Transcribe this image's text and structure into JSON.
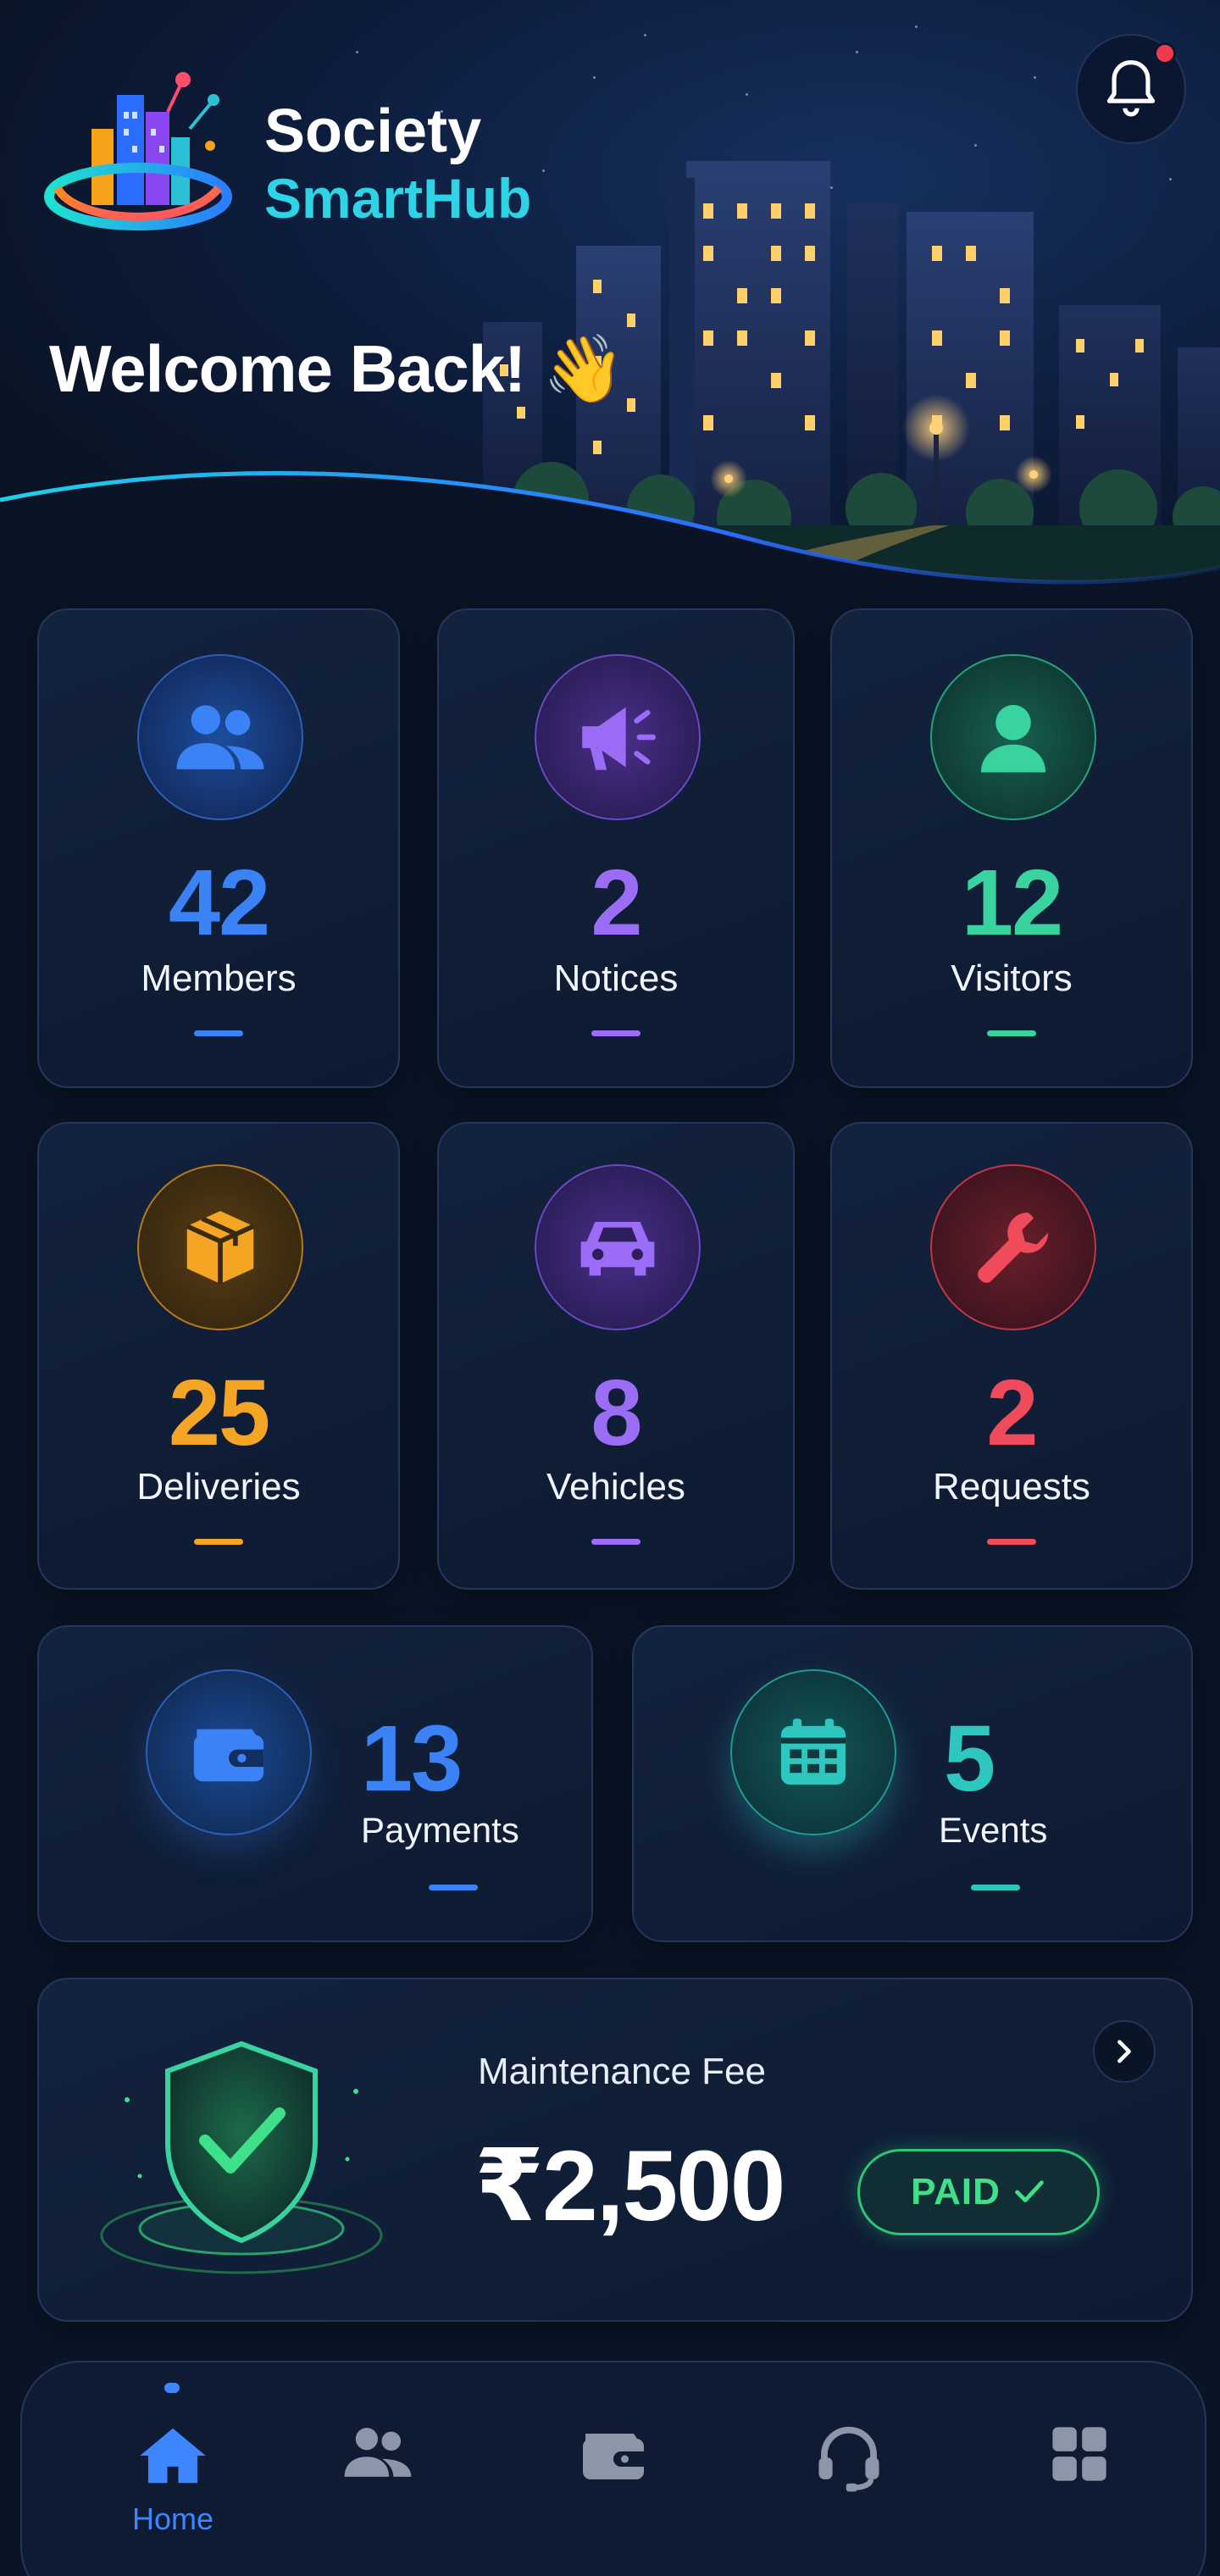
{
  "app": {
    "brand_line1": "Society",
    "brand_line2": "SmartHub",
    "welcome": "Welcome Back! 👋"
  },
  "notifications": {
    "has_unread": true
  },
  "stats": [
    {
      "id": "members",
      "value": "42",
      "label": "Members",
      "color": "#3b82f6",
      "icon": "users-icon"
    },
    {
      "id": "notices",
      "value": "2",
      "label": "Notices",
      "color": "#9b6cf5",
      "icon": "megaphone-icon"
    },
    {
      "id": "visitors",
      "value": "12",
      "label": "Visitors",
      "color": "#38d39f",
      "icon": "person-icon"
    },
    {
      "id": "deliveries",
      "value": "25",
      "label": "Deliveries",
      "color": "#f5a524",
      "icon": "package-icon"
    },
    {
      "id": "vehicles",
      "value": "8",
      "label": "Vehicles",
      "color": "#9b6cf5",
      "icon": "car-icon"
    },
    {
      "id": "requests",
      "value": "2",
      "label": "Requests",
      "color": "#ef4b5a",
      "icon": "wrench-icon"
    }
  ],
  "wide_stats": [
    {
      "id": "payments",
      "value": "13",
      "label": "Payments",
      "color": "#3b82f6",
      "icon": "wallet-icon"
    },
    {
      "id": "events",
      "value": "5",
      "label": "Events",
      "color": "#2ec7c0",
      "icon": "calendar-icon"
    }
  ],
  "maintenance": {
    "title": "Maintenance Fee",
    "amount": "₹2,500",
    "status": "PAID"
  },
  "nav": {
    "items": [
      {
        "id": "home",
        "label": "Home",
        "icon": "home-icon",
        "active": true
      },
      {
        "id": "members",
        "label": "",
        "icon": "users-icon",
        "active": false
      },
      {
        "id": "payments",
        "label": "",
        "icon": "wallet-icon",
        "active": false
      },
      {
        "id": "support",
        "label": "",
        "icon": "headset-icon",
        "active": false
      },
      {
        "id": "more",
        "label": "",
        "icon": "grid-icon",
        "active": false
      }
    ]
  }
}
